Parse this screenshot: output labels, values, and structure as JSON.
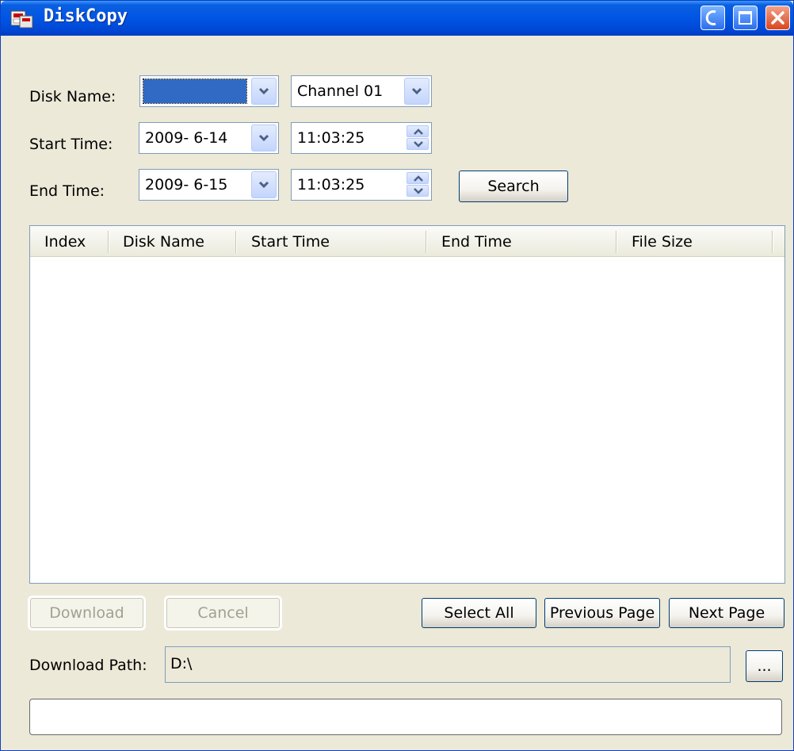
{
  "window": {
    "title": "DiskCopy",
    "icon": "app-icon"
  },
  "form": {
    "disk_name_label": "Disk Name:",
    "disk_name_value": "",
    "channel_value": "Channel 01",
    "start_time_label": "Start Time:",
    "start_date_value": "2009- 6-14",
    "start_clock_value": "11:03:25",
    "end_time_label": "End Time:",
    "end_date_value": "2009- 6-15",
    "end_clock_value": "11:03:25",
    "search_label": "Search"
  },
  "table": {
    "columns": [
      "Index",
      "Disk Name",
      "Start Time",
      "End Time",
      "File Size"
    ],
    "rows": []
  },
  "actions": {
    "download_label": "Download",
    "cancel_label": "Cancel",
    "select_all_label": "Select All",
    "previous_page_label": "Previous Page",
    "next_page_label": "Next Page"
  },
  "download": {
    "path_label": "Download Path:",
    "path_value": "D:\\",
    "browse_label": "..."
  },
  "colors": {
    "titlebar": "#0055e5",
    "window_bg": "#ece9d8",
    "selection": "#316ac5",
    "close_button": "#d9461c"
  }
}
